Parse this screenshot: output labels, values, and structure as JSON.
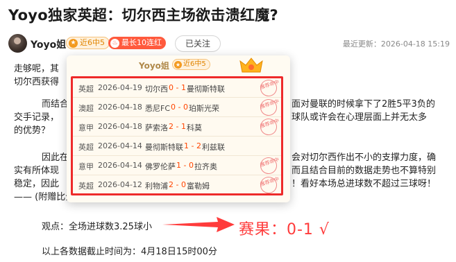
{
  "article": {
    "title": "Yoyo独家英超：切尔西主场欲击溃红魔?"
  },
  "author": {
    "name": "Yoyo姐",
    "badge_streak": "近6中5",
    "badge_long": "最长10连红",
    "follow_label": "已关注",
    "last_update": "最近更新：2026-04-18 15:19"
  },
  "body": {
    "lines": [
      "走够呢，其",
      "切尔西获得",
      "而结合",
      "交手记录，",
      "的优势？",
      "因此在",
      "实有所体现",
      "稳定，因此",
      "—— (附赠比分参考：",
      "面对曼联的时候拿下了2胜5平3负的",
      "球队或许会在心理层面上并无太多",
      "会对切尔西作出不小的支撑力度，确",
      "而且结合目前的数据走势也不算特别",
      "！看好本场总进球数不超过三球呀！"
    ],
    "prediction": "观点：全场进球数3.25球小",
    "deadline": "以上各数据截止时间为：4月18日15时00分"
  },
  "annotation": {
    "result": "赛果：0-1 √",
    "color": "#ff3b3b"
  },
  "popup": {
    "name": "Yoyo姐",
    "badge": "近6中5",
    "stamp_text": "推荐命中",
    "matches": [
      {
        "league": "英超",
        "date": "2026-04-19",
        "home": "切尔西",
        "score": "0 - 1",
        "away": "曼彻斯特联",
        "hit": true
      },
      {
        "league": "澳超",
        "date": "2026-04-18",
        "home": "悉尼FC",
        "score": "0 - 0",
        "away": "珀斯光荣",
        "hit": true
      },
      {
        "league": "意甲",
        "date": "2026-04-18",
        "home": "萨索洛",
        "score": "2 - 1",
        "away": "科莫",
        "hit": true
      },
      {
        "league": "英超",
        "date": "2026-04-14",
        "home": "曼彻斯特联",
        "score": "1 - 2",
        "away": "利兹联",
        "hit": false
      },
      {
        "league": "意甲",
        "date": "2026-04-14",
        "home": "佛罗伦萨",
        "score": "1 - 0",
        "away": "拉齐奥",
        "hit": true
      },
      {
        "league": "英超",
        "date": "2026-04-12",
        "home": "利物浦",
        "score": "2 - 0",
        "away": "富勒姆",
        "hit": true
      }
    ]
  }
}
